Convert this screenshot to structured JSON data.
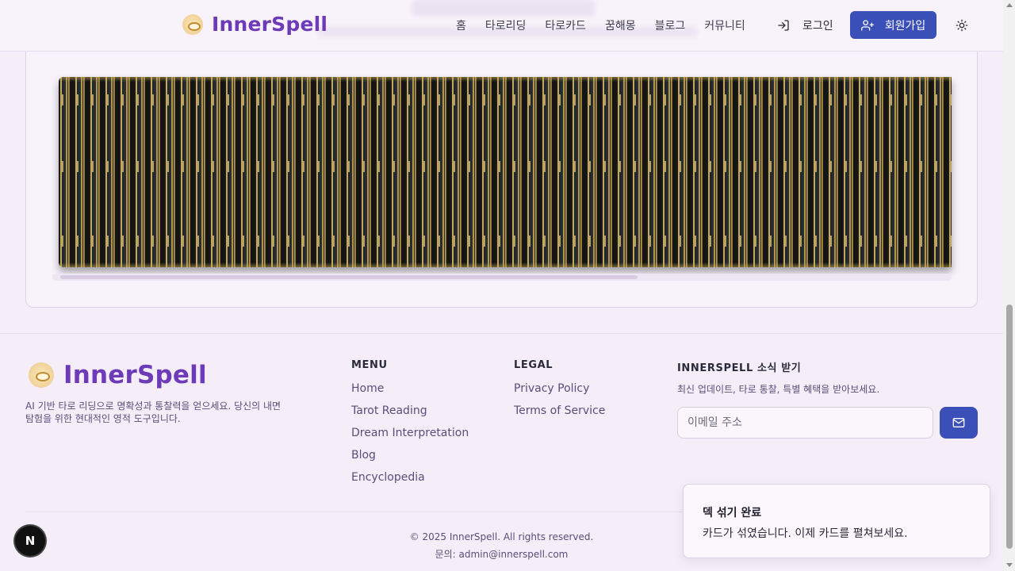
{
  "header": {
    "logo_text": "InnerSpell",
    "nav": [
      "홈",
      "타로리딩",
      "타로카드",
      "꿈해몽",
      "블로그",
      "커뮤니티"
    ],
    "login_label": "로그인",
    "signup_label": "회원가입",
    "icons": {
      "login": "log-in-icon",
      "signup": "user-plus-icon",
      "theme": "sun-icon"
    }
  },
  "deck": {
    "scroll_position": 0.0,
    "scroll_visible_fraction": 0.64
  },
  "footer": {
    "logo_text": "InnerSpell",
    "description": "AI 기반 타로 리딩으로 명확성과 통찰력을 얻으세요. 당신의 내면 탐험을 위한 현대적인 영적 도구입니다.",
    "menu_title": "MENU",
    "menu_links": [
      "Home",
      "Tarot Reading",
      "Dream Interpretation",
      "Blog",
      "Encyclopedia"
    ],
    "legal_title": "LEGAL",
    "legal_links": [
      "Privacy Policy",
      "Terms of Service"
    ],
    "newsletter_title": "INNERSPELL 소식 받기",
    "newsletter_desc": "최신 업데이트, 타로 통찰, 특별 혜택을 받아보세요.",
    "email_placeholder": "이메일 주소",
    "copyright": "© 2025 InnerSpell. All rights reserved.",
    "contact": "문의: admin@innerspell.com"
  },
  "toast": {
    "title": "덱 섞기 완료",
    "body": "카드가 섞였습니다. 이제 카드를 펼쳐보세요."
  },
  "next_badge": "N"
}
